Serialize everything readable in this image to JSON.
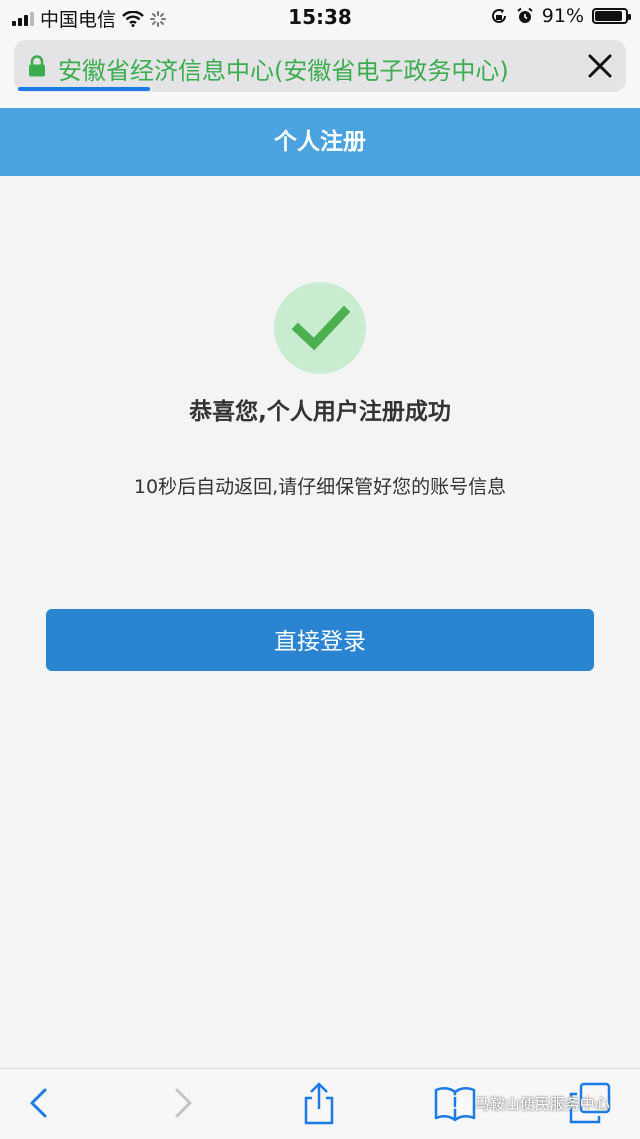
{
  "status_bar": {
    "carrier": "中国电信",
    "time": "15:38",
    "battery_percent": "91%",
    "battery_level": 0.91,
    "icons": [
      "signal-icon",
      "wifi-icon",
      "loading-icon",
      "rotation-lock-icon",
      "alarm-icon",
      "battery-icon"
    ]
  },
  "browser": {
    "url_text": "安徽省经济信息中心(安徽省电子政务中心)",
    "load_progress": 0.22,
    "accent": "#1a7ae6",
    "url_color": "#3bad4f"
  },
  "header": {
    "title": "个人注册",
    "color": "#4aa3df"
  },
  "main": {
    "success_title": "恭喜您,个人用户注册成功",
    "success_hint": "10秒后自动返回,请仔细保管好您的账号信息",
    "login_button": "直接登录",
    "check_color": "#4caf50",
    "button_color": "#2a84d2"
  },
  "toolbar": {
    "icons": [
      "back-icon",
      "forward-icon",
      "share-icon",
      "bookmarks-icon",
      "tabs-icon"
    ]
  },
  "watermark": {
    "text": "马鞍山便民服务中心"
  }
}
